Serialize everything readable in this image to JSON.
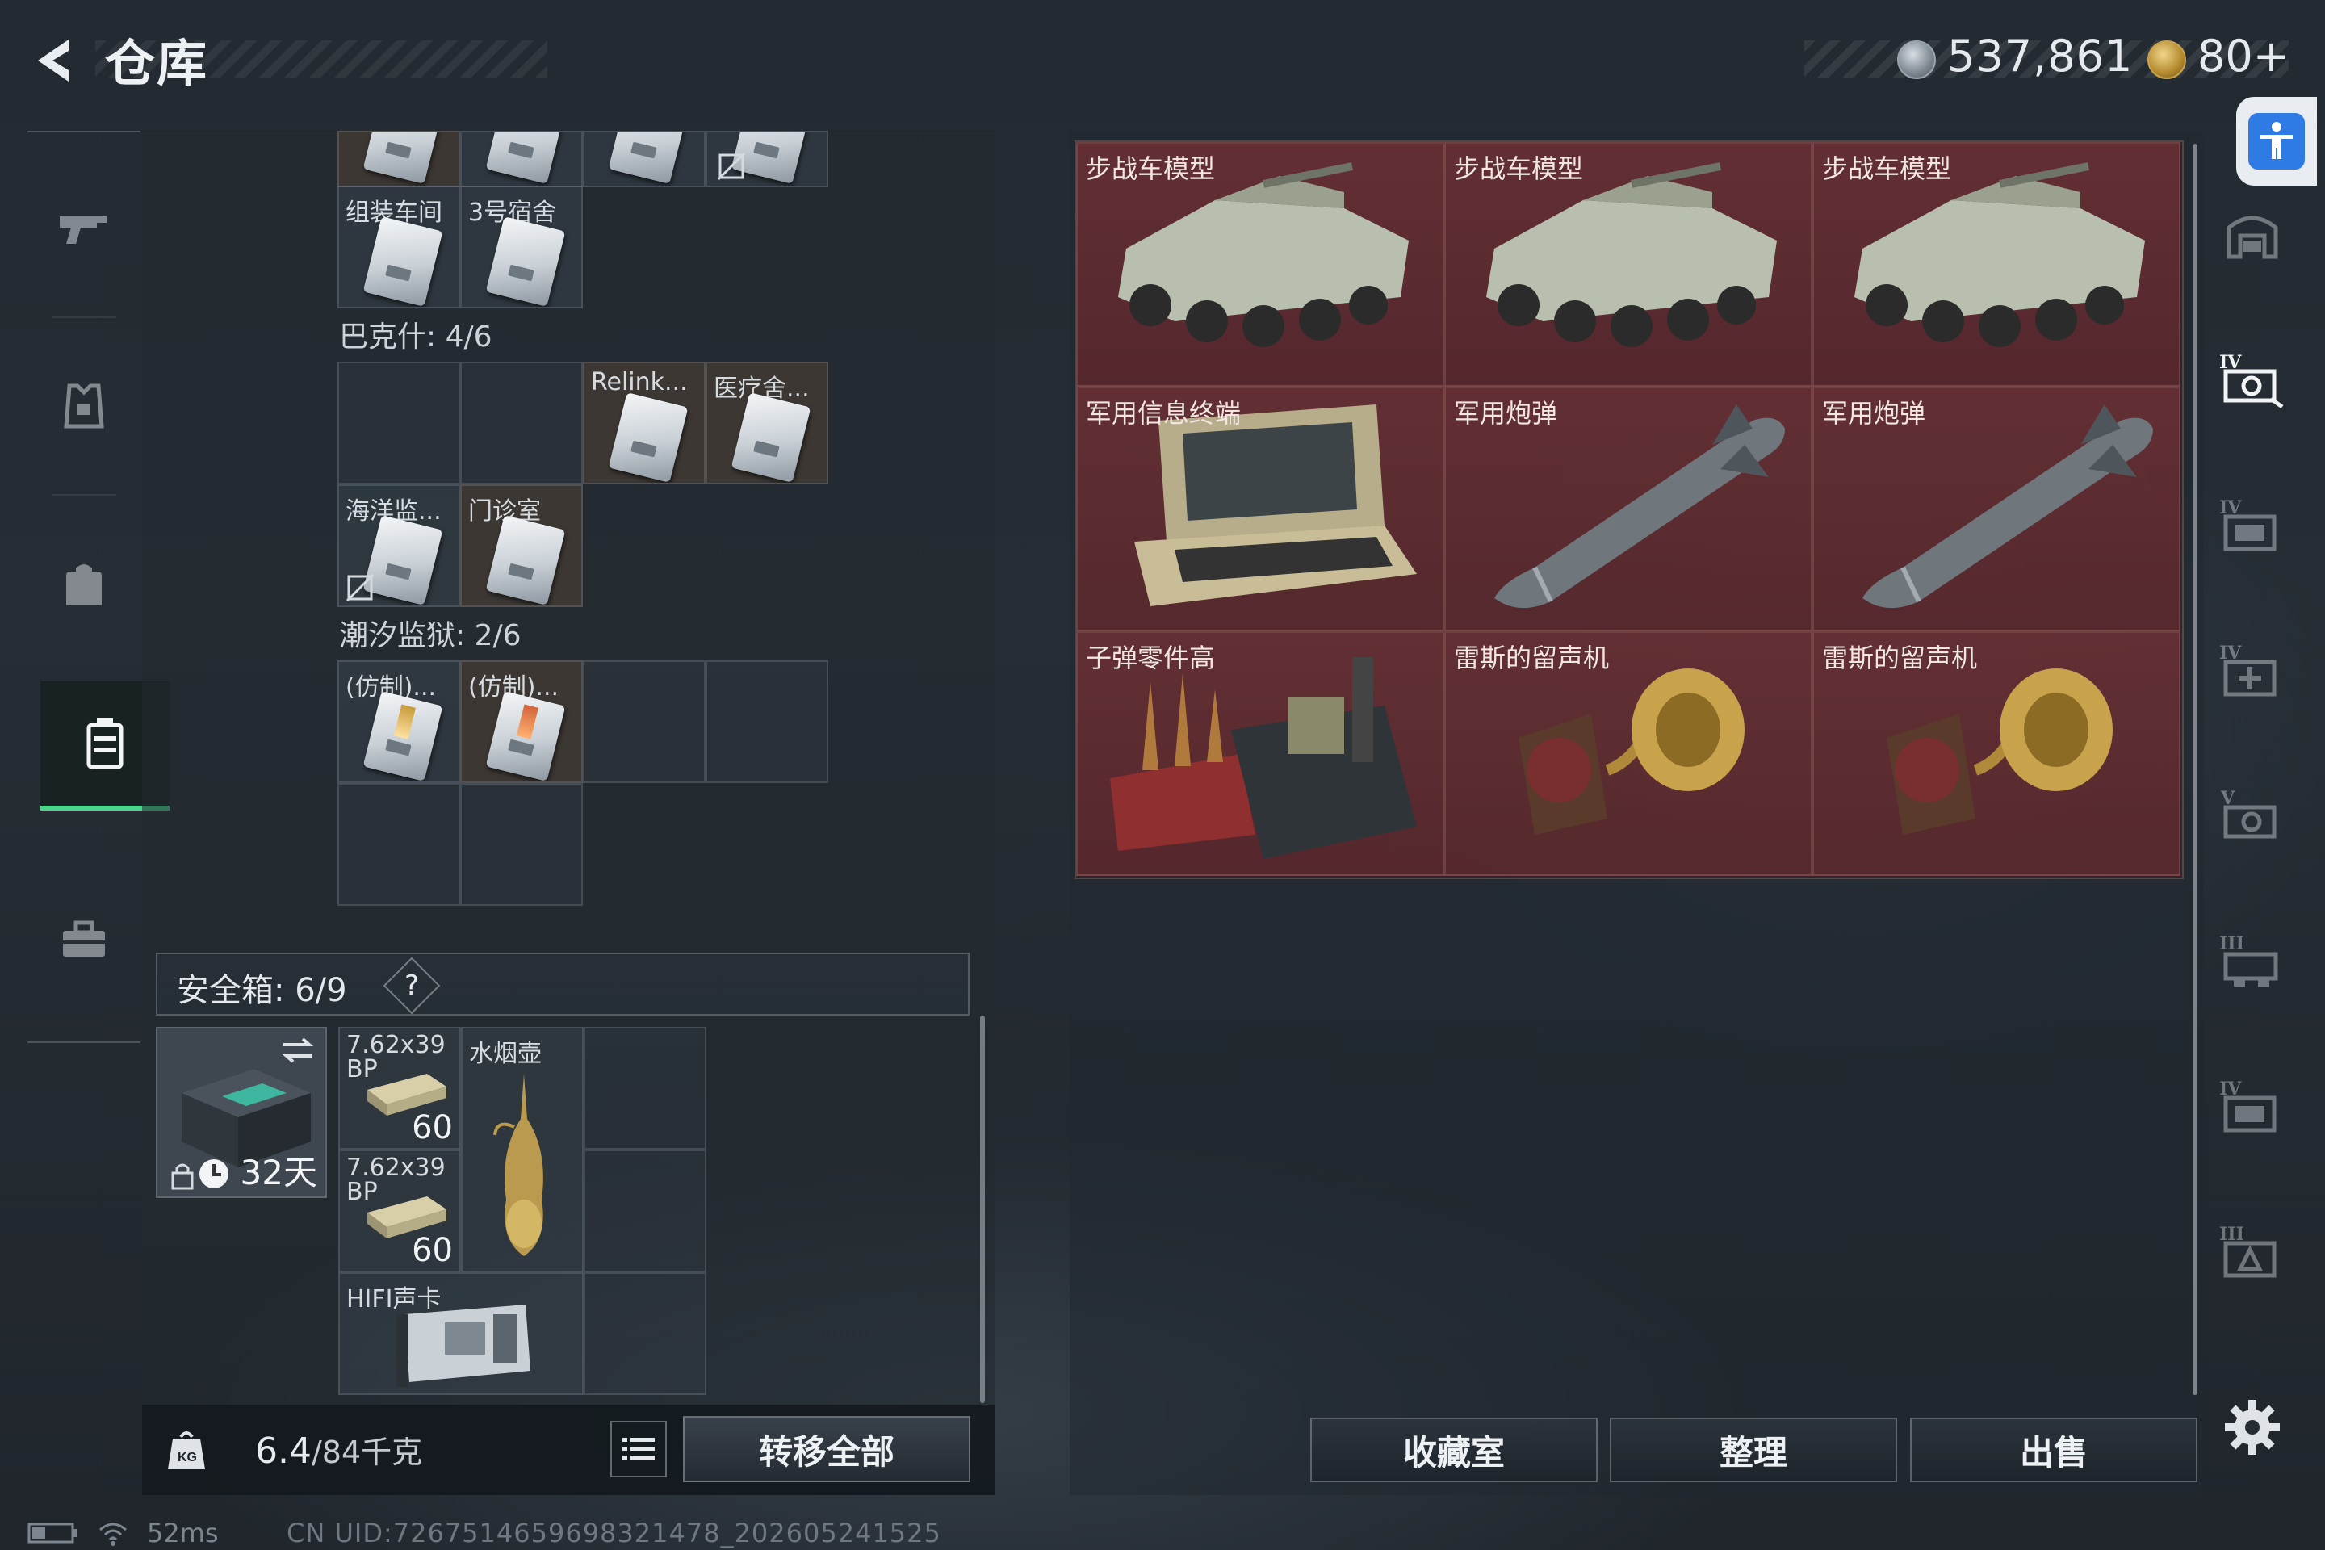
{
  "header": {
    "title": "仓库",
    "currency1": "537,861",
    "currency2": "80+"
  },
  "left": {
    "row0_labels": [
      "",
      "",
      "",
      ""
    ],
    "grid1_labels": [
      "组装车间",
      "3号宿舍"
    ],
    "bakshi_title": "巴克什: 4/6",
    "grid2_labels": [
      "Relink...",
      "医疗舍...",
      "海洋监...",
      "门诊室"
    ],
    "tide_title": "潮汐监狱: 2/6",
    "grid3_labels": [
      "(仿制)...",
      "(仿制)..."
    ],
    "safe_title": "安全箱: 6/9",
    "safe_help": "?",
    "safe_days": "32天",
    "safe_items": [
      {
        "label": "7.62x39 BP",
        "count": "60"
      },
      {
        "label": "水烟壶",
        "count": ""
      },
      {
        "label": "7.62x39 BP",
        "count": "60"
      },
      {
        "label": "HIFI声卡",
        "count": ""
      }
    ],
    "weight_value": "6.4",
    "weight_max": "/84千克",
    "transfer_all": "转移全部"
  },
  "right": {
    "items": [
      {
        "label": "步战车模型",
        "icon": "ifv-model"
      },
      {
        "label": "步战车模型",
        "icon": "ifv-model"
      },
      {
        "label": "步战车模型",
        "icon": "ifv-model"
      },
      {
        "label": "军用信息终端",
        "icon": "military-terminal"
      },
      {
        "label": "军用炮弹",
        "icon": "artillery-shell"
      },
      {
        "label": "军用炮弹",
        "icon": "artillery-shell"
      },
      {
        "label": "子弹零件高",
        "icon": "ammo-parts"
      },
      {
        "label": "雷斯的留声机",
        "icon": "gramophone"
      },
      {
        "label": "雷斯的留声机",
        "icon": "gramophone"
      }
    ],
    "buttons": {
      "collection": "收藏室",
      "sort": "整理",
      "sell": "出售"
    }
  },
  "status": {
    "ping": "52ms",
    "uid": "CN UID:7267514659698321478_202605241525"
  },
  "colors": {
    "accent_green": "#4bd38a",
    "item_highlight": "#6e2f33",
    "accessibility_blue": "#2f7be6"
  }
}
